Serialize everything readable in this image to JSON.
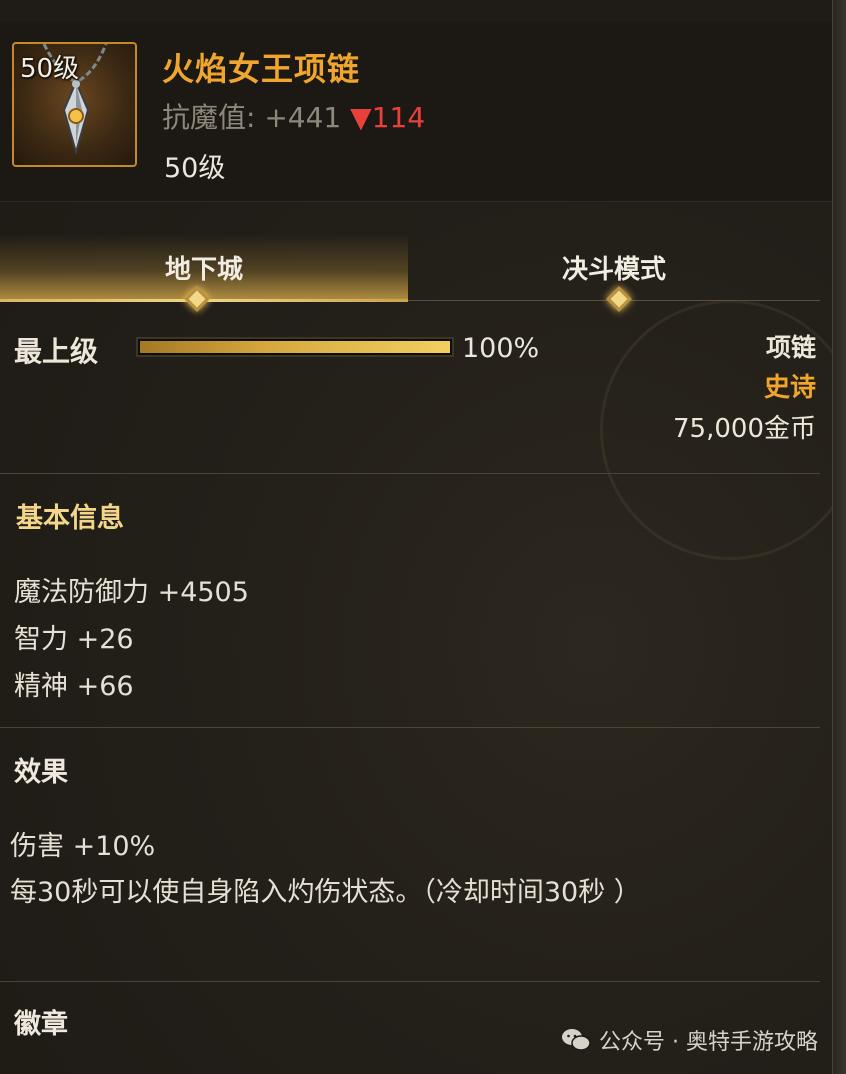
{
  "item": {
    "level_badge": "50级",
    "name": "火焰女王项链",
    "stat_label": "抗魔值:",
    "stat_value": "+441",
    "stat_delta": "▼114",
    "level_text": "50级"
  },
  "tabs": [
    {
      "label": "地下城",
      "active": true
    },
    {
      "label": "决斗模式",
      "active": false
    }
  ],
  "rank": {
    "label": "最上级",
    "progress": 1.0,
    "percent_text": "100%"
  },
  "meta": {
    "type": "项链",
    "rarity": "史诗",
    "price": "75,000金币"
  },
  "basic_info": {
    "title": "基本信息",
    "lines": [
      "魔法防御力 +4505",
      "智力 +26",
      "精神 +66"
    ]
  },
  "effect": {
    "title": "效果",
    "lines": [
      "伤害 +10%",
      "每30秒可以使自身陷入灼伤状态。（冷却时间30秒 ）"
    ]
  },
  "emblem": {
    "title": "徽章"
  },
  "watermark": {
    "text": "公众号 · 奥特手游攻略",
    "icon": "wechat-icon"
  },
  "colors": {
    "item_name": "#f0a62e",
    "rarity": "#f0a62e",
    "delta_down": "#e8413b",
    "section_title": "#f3d68a"
  }
}
